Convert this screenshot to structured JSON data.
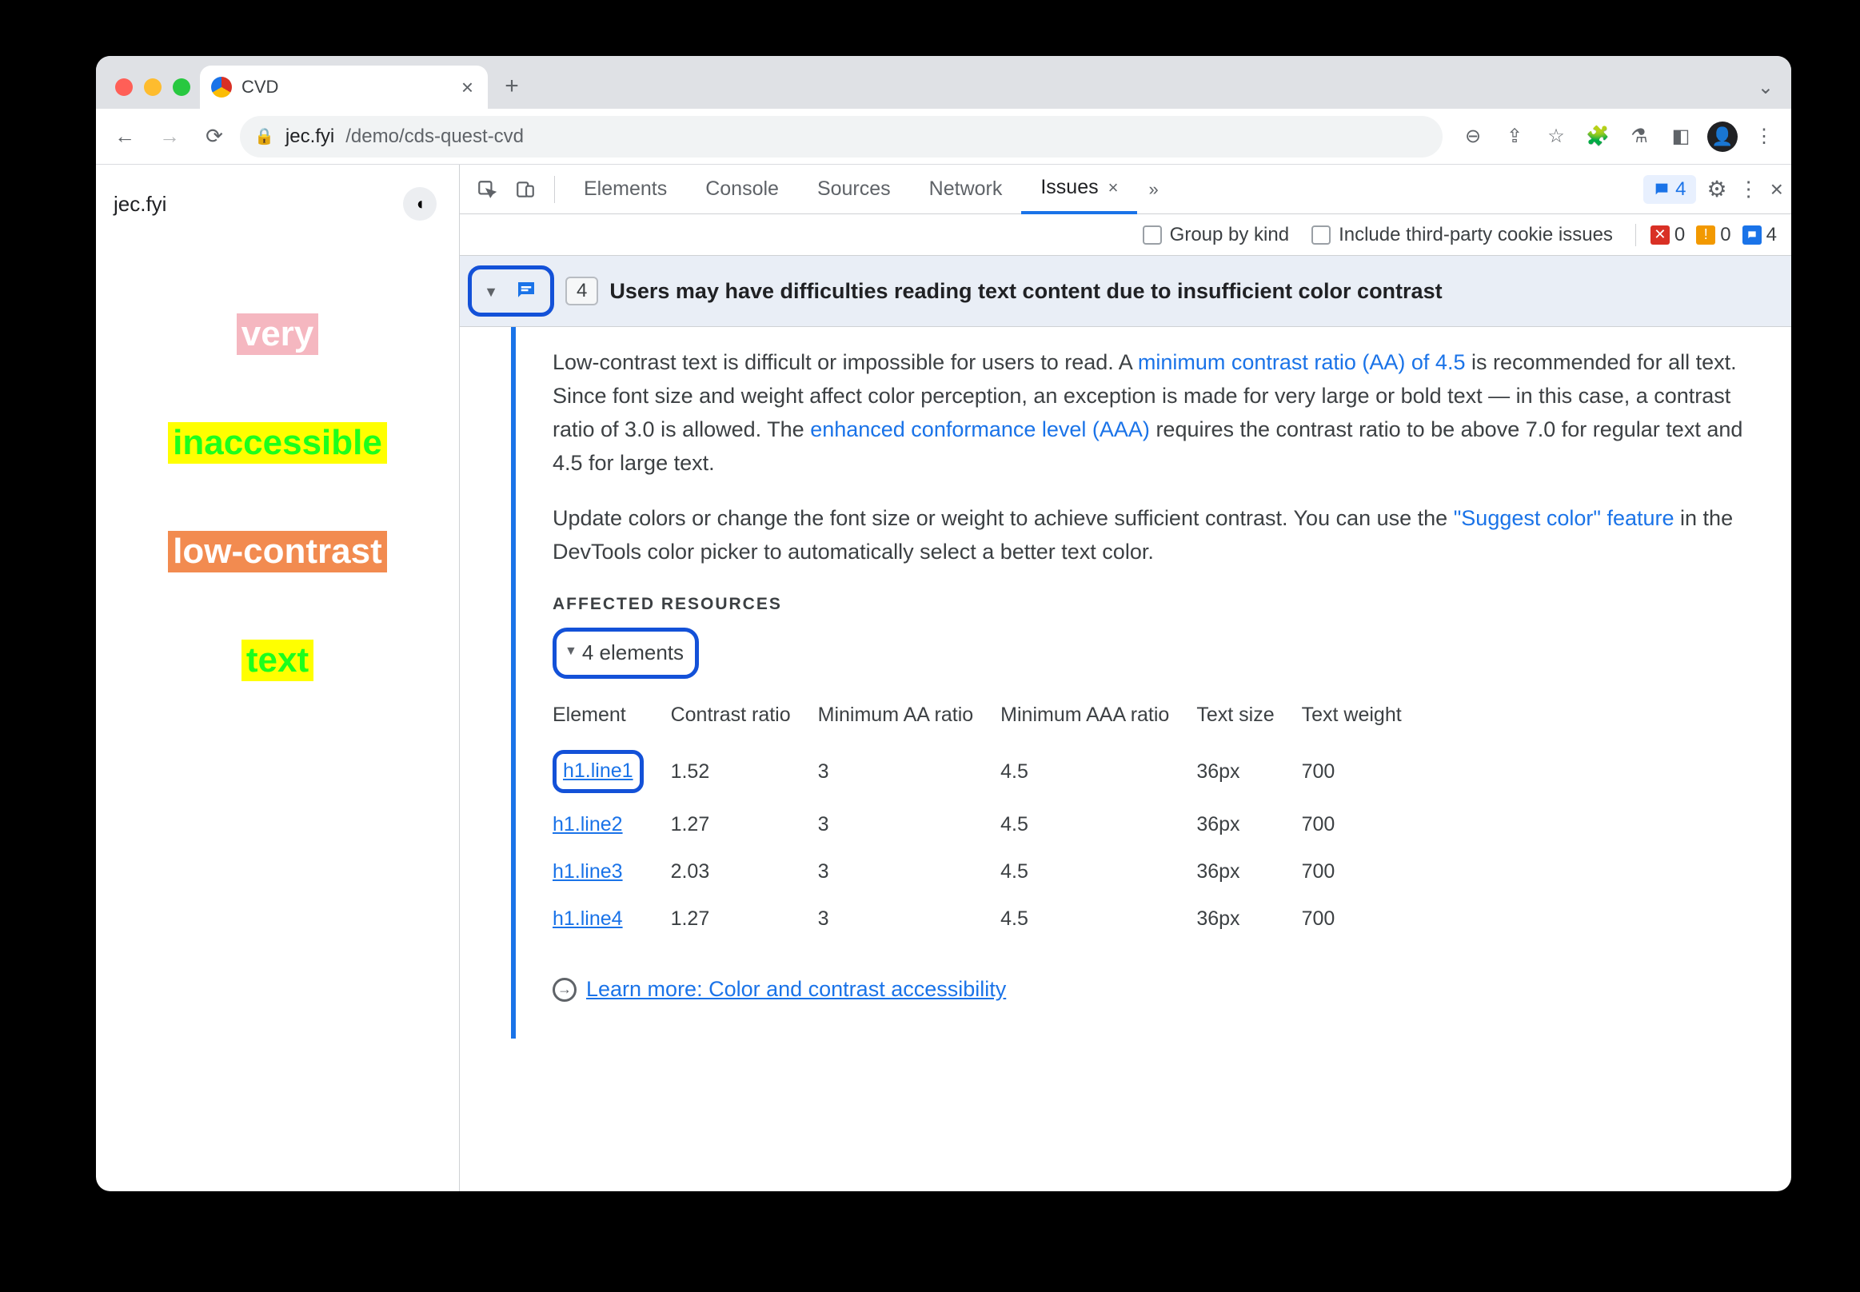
{
  "browser": {
    "tab_title": "CVD",
    "url_host": "jec.fyi",
    "url_path": "/demo/cds-quest-cvd"
  },
  "page": {
    "site_label": "jec.fyi",
    "lines": [
      "very",
      "inaccessible",
      "low-contrast",
      "text"
    ]
  },
  "devtools": {
    "tabs": [
      "Elements",
      "Console",
      "Sources",
      "Network"
    ],
    "active_tab": "Issues",
    "msg_count": "4"
  },
  "filters": {
    "group_by_kind": "Group by kind",
    "third_party": "Include third-party cookie issues",
    "error_count": "0",
    "warn_count": "0",
    "info_count": "4"
  },
  "issue": {
    "count": "4",
    "title": "Users may have difficulties reading text content due to insufficient color contrast",
    "para1_prefix": "Low-contrast text is difficult or impossible for users to read. A ",
    "link_aa": "minimum contrast ratio (AA) of 4.5",
    "para1_mid": " is recommended for all text. Since font size and weight affect color perception, an exception is made for very large or bold text — in this case, a contrast ratio of 3.0 is allowed. The ",
    "link_aaa": "enhanced conformance level (AAA)",
    "para1_suffix": " requires the contrast ratio to be above 7.0 for regular text and 4.5 for large text.",
    "para2_prefix": "Update colors or change the font size or weight to achieve sufficient contrast. You can use the ",
    "link_suggest": "\"Suggest color\" feature",
    "para2_suffix": " in the DevTools color picker to automatically select a better text color.",
    "affected_header": "AFFECTED RESOURCES",
    "elements_label": "4 elements",
    "columns": [
      "Element",
      "Contrast ratio",
      "Minimum AA ratio",
      "Minimum AAA ratio",
      "Text size",
      "Text weight"
    ],
    "rows": [
      {
        "el": "h1.line1",
        "cr": "1.52",
        "aa": "3",
        "aaa": "4.5",
        "ts": "36px",
        "tw": "700"
      },
      {
        "el": "h1.line2",
        "cr": "1.27",
        "aa": "3",
        "aaa": "4.5",
        "ts": "36px",
        "tw": "700"
      },
      {
        "el": "h1.line3",
        "cr": "2.03",
        "aa": "3",
        "aaa": "4.5",
        "ts": "36px",
        "tw": "700"
      },
      {
        "el": "h1.line4",
        "cr": "1.27",
        "aa": "3",
        "aaa": "4.5",
        "ts": "36px",
        "tw": "700"
      }
    ],
    "learn_more": "Learn more: Color and contrast accessibility"
  }
}
